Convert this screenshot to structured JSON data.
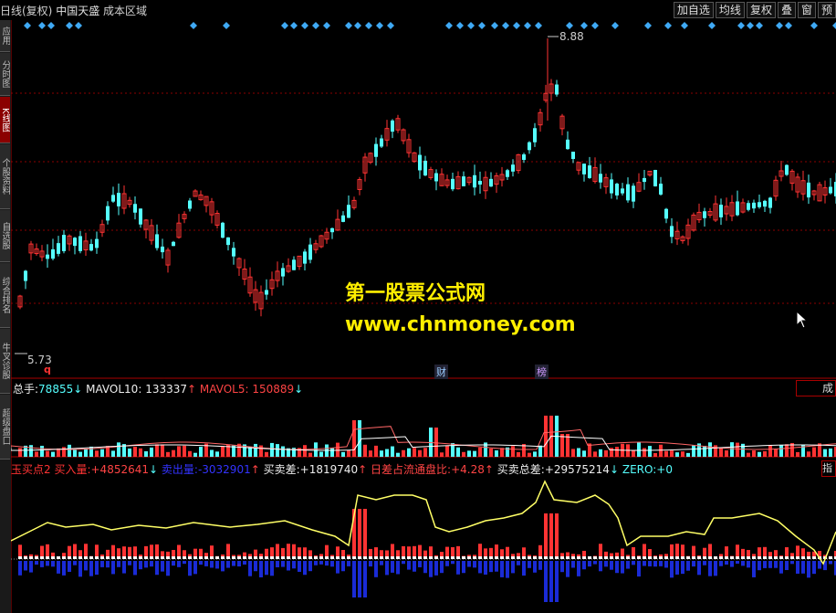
{
  "header": {
    "period": "日线(复权)",
    "stock": "中国天盛",
    "overlay": "成本区域",
    "buttons": [
      "加自选",
      "均线",
      "复权",
      "叠",
      "窗",
      "预"
    ]
  },
  "left_tabs": [
    "应用",
    "分时图",
    "K线图",
    "个股资料",
    "自选股",
    "综合排名",
    "牛叉诊股",
    "超级盘口"
  ],
  "chart": {
    "high_label": "8.88",
    "low_label": "5.73",
    "markers": {
      "q": "q",
      "cai": "财",
      "bang": "榜"
    }
  },
  "watermark": {
    "line1": "第一股票公式网",
    "line2": "www.chnmoney.com"
  },
  "volume_legend": {
    "total_label": "总手:",
    "total_value": "78855",
    "mavol10_label": "MAVOL10:",
    "mavol10_value": "133337",
    "mavol5_label": "MAVOL5:",
    "mavol5_value": "150889",
    "side_button": "成"
  },
  "indicator_legend": {
    "buy_label": "玉买点2 买入量:",
    "buy_value": "+4852641",
    "sell_label": "卖出量:",
    "sell_value": "-3032901",
    "diff_label": "买卖差:",
    "diff_value": "+1819740",
    "ratio_label": "日差占流通盘比:",
    "ratio_value": "+4.28",
    "total_label": "买卖总差:",
    "total_value": "+29575214",
    "zero_label": "ZERO:",
    "zero_value": "+0",
    "side_button": "指"
  },
  "colors": {
    "up": "#ff3333",
    "down": "#55ffff",
    "background": "#000000",
    "grid": "#8b0000",
    "ind_line": "#ffff66"
  }
}
